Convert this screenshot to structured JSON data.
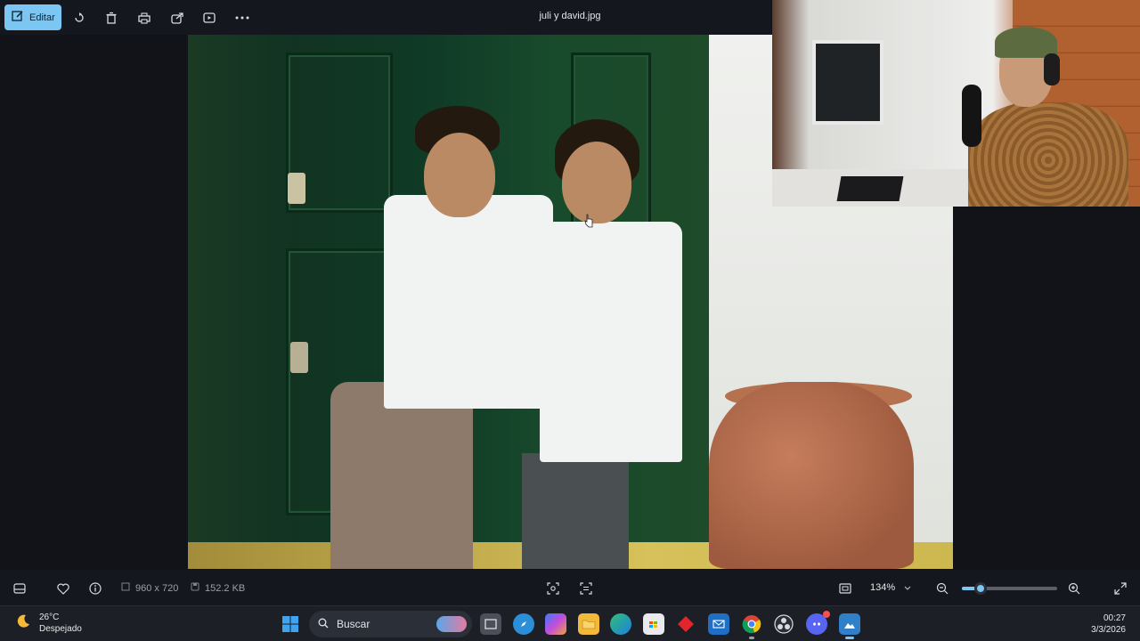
{
  "toolbar": {
    "edit_label": "Editar",
    "file_name": "juli y david.jpg",
    "icons": [
      "edit-icon",
      "rotate-icon",
      "delete-icon",
      "print-icon",
      "share-icon",
      "slideshow-icon",
      "more-icon"
    ]
  },
  "info_bar": {
    "dimensions": "960 x 720",
    "file_size": "152.2 KB",
    "zoom": "134%",
    "zoom_fraction": 0.2
  },
  "taskbar": {
    "weather_temp": "26°C",
    "weather_desc": "Despejado",
    "search_placeholder": "Buscar",
    "time": "00:27",
    "date": "3/3/2026"
  },
  "colors": {
    "accent": "#7cc6f3",
    "toolbar_bg": "#15171e"
  }
}
